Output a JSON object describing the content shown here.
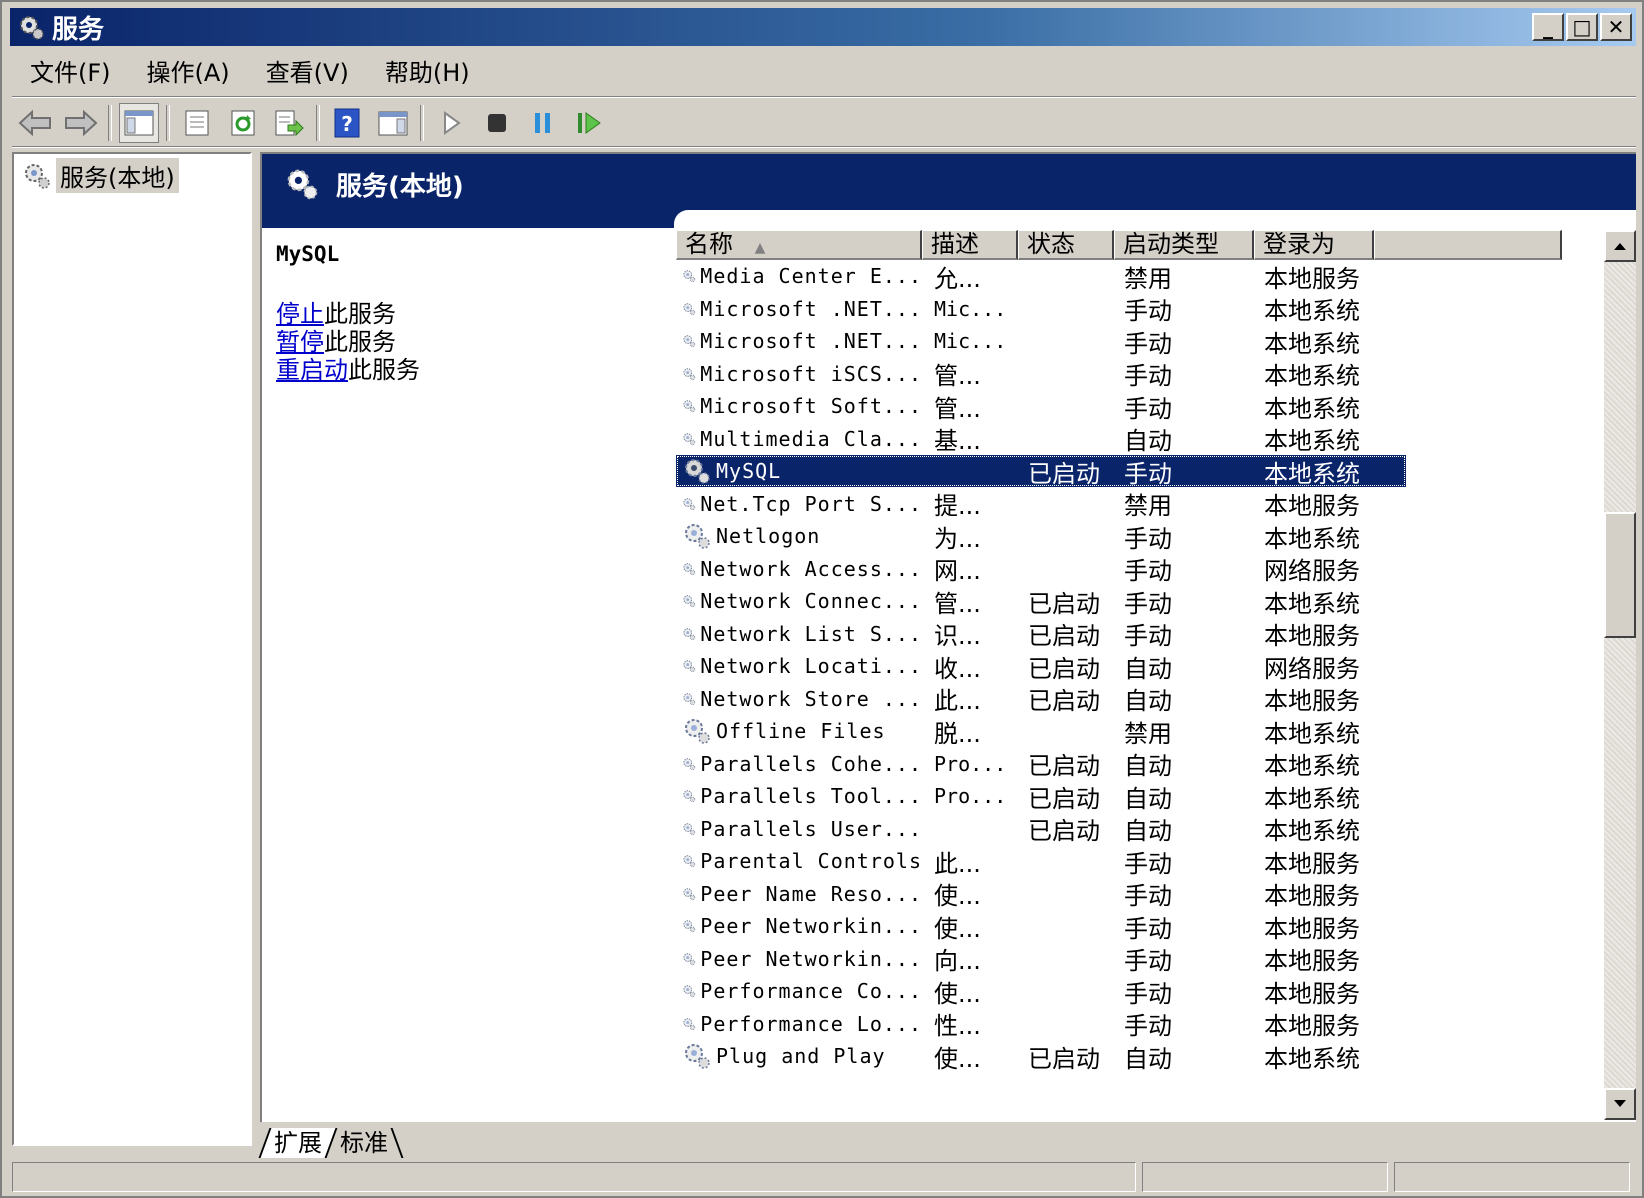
{
  "window": {
    "title": "服务",
    "minimize": "_",
    "maximize": "□",
    "close": "✕"
  },
  "menu": [
    {
      "label": "文件(F)"
    },
    {
      "label": "操作(A)"
    },
    {
      "label": "查看(V)"
    },
    {
      "label": "帮助(H)"
    }
  ],
  "toolbar": [
    {
      "name": "back-icon"
    },
    {
      "name": "forward-icon"
    },
    {
      "name": "show-hide-tree-icon"
    },
    {
      "name": "properties-icon"
    },
    {
      "name": "refresh-icon"
    },
    {
      "name": "export-list-icon"
    },
    {
      "name": "help-icon"
    },
    {
      "name": "show-action-pane-icon"
    },
    {
      "name": "start-service-icon"
    },
    {
      "name": "stop-service-icon"
    },
    {
      "name": "pause-service-icon"
    },
    {
      "name": "restart-service-icon"
    }
  ],
  "tree": {
    "root_label": "服务(本地)"
  },
  "header": {
    "title": "服务(本地)"
  },
  "detail": {
    "service_name": "MySQL",
    "actions": [
      {
        "link": "停止",
        "suffix": "此服务"
      },
      {
        "link": "暂停",
        "suffix": "此服务"
      },
      {
        "link": "重启动",
        "suffix": "此服务"
      }
    ]
  },
  "columns": {
    "name": "名称",
    "desc": "描述",
    "status": "状态",
    "startup": "启动类型",
    "logon": "登录为",
    "sort_indicator": "▲"
  },
  "services": [
    {
      "name": "Media Center E...",
      "desc": "允...",
      "status": "",
      "startup": "禁用",
      "logon": "本地服务"
    },
    {
      "name": "Microsoft .NET...",
      "desc": "Mic...",
      "status": "",
      "startup": "手动",
      "logon": "本地系统"
    },
    {
      "name": "Microsoft .NET...",
      "desc": "Mic...",
      "status": "",
      "startup": "手动",
      "logon": "本地系统"
    },
    {
      "name": "Microsoft iSCS...",
      "desc": "管...",
      "status": "",
      "startup": "手动",
      "logon": "本地系统"
    },
    {
      "name": "Microsoft Soft...",
      "desc": "管...",
      "status": "",
      "startup": "手动",
      "logon": "本地系统"
    },
    {
      "name": "Multimedia Cla...",
      "desc": "基...",
      "status": "",
      "startup": "自动",
      "logon": "本地系统"
    },
    {
      "name": "MySQL",
      "desc": "",
      "status": "已启动",
      "startup": "手动",
      "logon": "本地系统",
      "selected": true
    },
    {
      "name": "Net.Tcp Port S...",
      "desc": "提...",
      "status": "",
      "startup": "禁用",
      "logon": "本地服务"
    },
    {
      "name": "Netlogon",
      "desc": "为...",
      "status": "",
      "startup": "手动",
      "logon": "本地系统"
    },
    {
      "name": "Network Access...",
      "desc": "网...",
      "status": "",
      "startup": "手动",
      "logon": "网络服务"
    },
    {
      "name": "Network Connec...",
      "desc": "管...",
      "status": "已启动",
      "startup": "手动",
      "logon": "本地系统"
    },
    {
      "name": "Network List S...",
      "desc": "识...",
      "status": "已启动",
      "startup": "手动",
      "logon": "本地服务"
    },
    {
      "name": "Network Locati...",
      "desc": "收...",
      "status": "已启动",
      "startup": "自动",
      "logon": "网络服务"
    },
    {
      "name": "Network Store ...",
      "desc": "此...",
      "status": "已启动",
      "startup": "自动",
      "logon": "本地服务"
    },
    {
      "name": "Offline Files",
      "desc": "脱...",
      "status": "",
      "startup": "禁用",
      "logon": "本地系统"
    },
    {
      "name": "Parallels Cohe...",
      "desc": "Pro...",
      "status": "已启动",
      "startup": "自动",
      "logon": "本地系统"
    },
    {
      "name": "Parallels Tool...",
      "desc": "Pro...",
      "status": "已启动",
      "startup": "自动",
      "logon": "本地系统"
    },
    {
      "name": "Parallels User...",
      "desc": "",
      "status": "已启动",
      "startup": "自动",
      "logon": "本地系统"
    },
    {
      "name": "Parental Controls",
      "desc": "此...",
      "status": "",
      "startup": "手动",
      "logon": "本地服务"
    },
    {
      "name": "Peer Name Reso...",
      "desc": "使...",
      "status": "",
      "startup": "手动",
      "logon": "本地服务"
    },
    {
      "name": "Peer Networkin...",
      "desc": "使...",
      "status": "",
      "startup": "手动",
      "logon": "本地服务"
    },
    {
      "name": "Peer Networkin...",
      "desc": "向...",
      "status": "",
      "startup": "手动",
      "logon": "本地服务"
    },
    {
      "name": "Performance Co...",
      "desc": "使...",
      "status": "",
      "startup": "手动",
      "logon": "本地服务"
    },
    {
      "name": "Performance Lo...",
      "desc": "性...",
      "status": "",
      "startup": "手动",
      "logon": "本地服务"
    },
    {
      "name": "Plug and Play",
      "desc": "使...",
      "status": "已启动",
      "startup": "自动",
      "logon": "本地系统"
    }
  ],
  "tabs": [
    {
      "label": "扩展",
      "active": true
    },
    {
      "label": "标准",
      "active": false
    }
  ],
  "colors": {
    "selection": "#0a246a",
    "link": "#0000cc",
    "chrome": "#d4d0c8"
  }
}
